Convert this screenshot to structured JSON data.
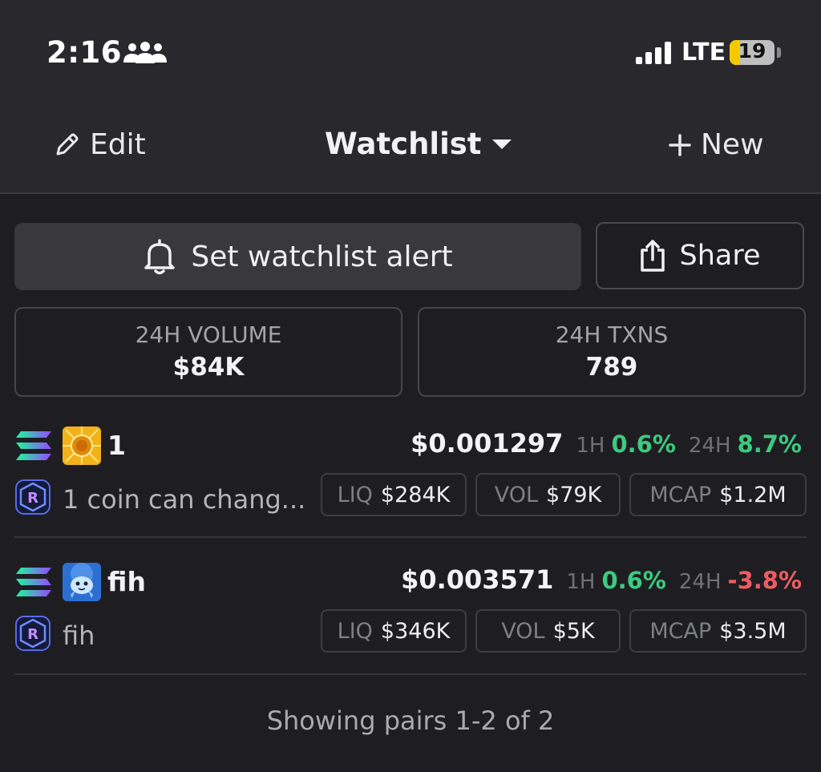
{
  "status_bar": {
    "time": "2:16",
    "people_icon": "people-group-icon",
    "network": "LTE",
    "battery": "19",
    "battery_color": "#f5c900"
  },
  "nav": {
    "edit_label": "Edit",
    "title": "Watchlist",
    "new_label": "New"
  },
  "actions": {
    "alert_label": "Set watchlist alert",
    "share_label": "Share"
  },
  "stats": [
    {
      "label": "24H VOLUME",
      "value": "$84K"
    },
    {
      "label": "24H TXNS",
      "value": "789"
    }
  ],
  "pairs": [
    {
      "symbol": "1",
      "name": "1 coin can chang...",
      "chain_icon": "solana-icon",
      "dex_icon": "raydium-icon",
      "avatar_icon": "gold-coin-icon",
      "price": "$0.001297",
      "h1_label": "1H",
      "h1": "0.6%",
      "h1_dir": "up",
      "h24_label": "24H",
      "h24": "8.7%",
      "h24_dir": "up",
      "liq_label": "LIQ",
      "liq": "$284K",
      "vol_label": "VOL",
      "vol": "$79K",
      "mcap_label": "MCAP",
      "mcap": "$1.2M"
    },
    {
      "symbol": "fih",
      "name": "fih",
      "chain_icon": "solana-icon",
      "dex_icon": "raydium-icon",
      "avatar_icon": "blue-fish-icon",
      "price": "$0.003571",
      "h1_label": "1H",
      "h1": "0.6%",
      "h1_dir": "up",
      "h24_label": "24H",
      "h24": "-3.8%",
      "h24_dir": "down",
      "liq_label": "LIQ",
      "liq": "$346K",
      "vol_label": "VOL",
      "vol": "$5K",
      "mcap_label": "MCAP",
      "mcap": "$3.5M"
    }
  ],
  "footer": "Showing pairs 1-2 of 2",
  "colors": {
    "background": "#1e1e22",
    "header": "#29292d",
    "positive": "#3ccb7f",
    "negative": "#ef5b62"
  }
}
